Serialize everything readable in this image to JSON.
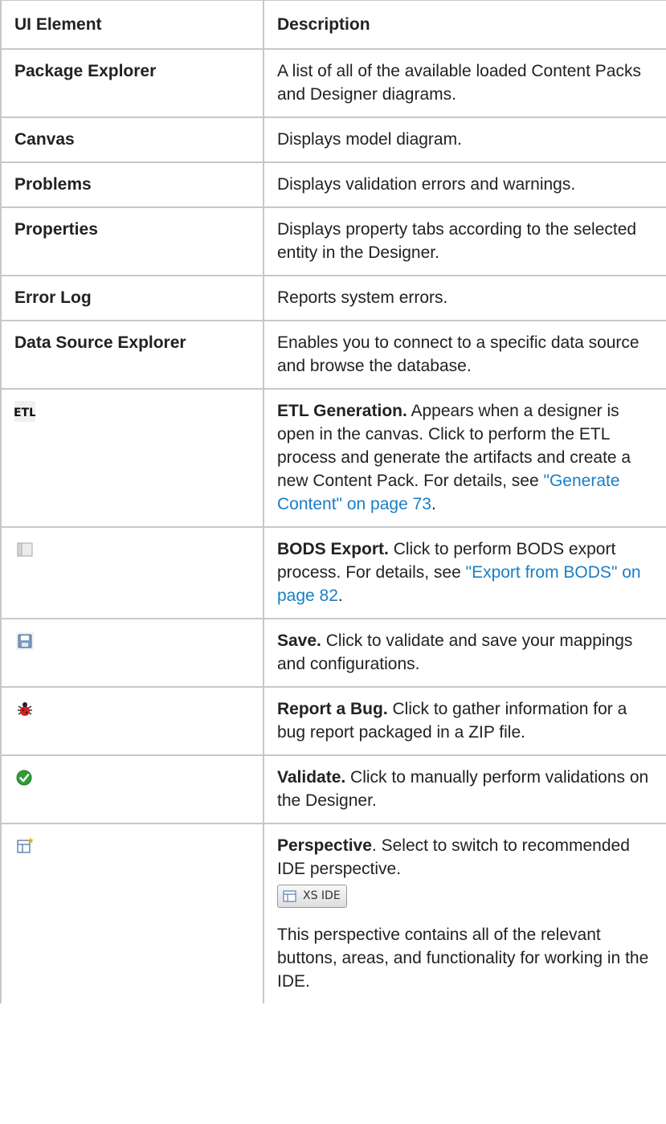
{
  "table": {
    "header": {
      "col1": "UI Element",
      "col2": "Description"
    },
    "rows": [
      {
        "name": "Package Explorer",
        "desc": "A list of all of the available loaded Content Packs and Designer diagrams."
      },
      {
        "name": "Canvas",
        "desc": "Displays model diagram."
      },
      {
        "name": "Problems",
        "desc": "Displays validation errors and warnings."
      },
      {
        "name": "Properties",
        "desc": "Displays property tabs according to the selected entity in the Designer."
      },
      {
        "name": "Error Log",
        "desc": "Reports system errors."
      },
      {
        "name": "Data Source Explorer",
        "desc": "Enables you to connect to a specific data source and browse the database."
      }
    ],
    "icon_rows": {
      "etl": {
        "icon": "etl-icon",
        "icon_text": "ETL",
        "lead": "ETL Generation.",
        "text": " Appears when a designer is open in the canvas. Click to perform the ETL process and generate the artifacts and create a new Content Pack. For details, see ",
        "link": "\"Generate Content\" on page 73",
        "end": "."
      },
      "bods": {
        "icon": "book-icon",
        "lead": "BODS Export.",
        "text": " Click to perform BODS export process. For details, see ",
        "link": "\"Export from BODS\" on page 82",
        "end": "."
      },
      "save": {
        "icon": "floppy-disk-icon",
        "lead": "Save.",
        "text": " Click to validate and save your mappings and configurations."
      },
      "bug": {
        "icon": "bug-icon",
        "lead": "Report a Bug.",
        "text": " Click to gather information for a bug report packaged in a ZIP file."
      },
      "validate": {
        "icon": "check-circle-icon",
        "lead": "Validate.",
        "text": " Click to manually perform validations on the Designer."
      },
      "perspective": {
        "icon": "perspective-icon",
        "lead": "Perspective",
        "text": ". Select to switch to recommended IDE perspective.",
        "button_label": "XS IDE",
        "text2": "This perspective contains all of the relevant buttons, areas, and functionality for working in the IDE."
      }
    }
  },
  "colors": {
    "link": "#1a7ec4",
    "border": "#c8c8c8",
    "text": "#222222"
  }
}
